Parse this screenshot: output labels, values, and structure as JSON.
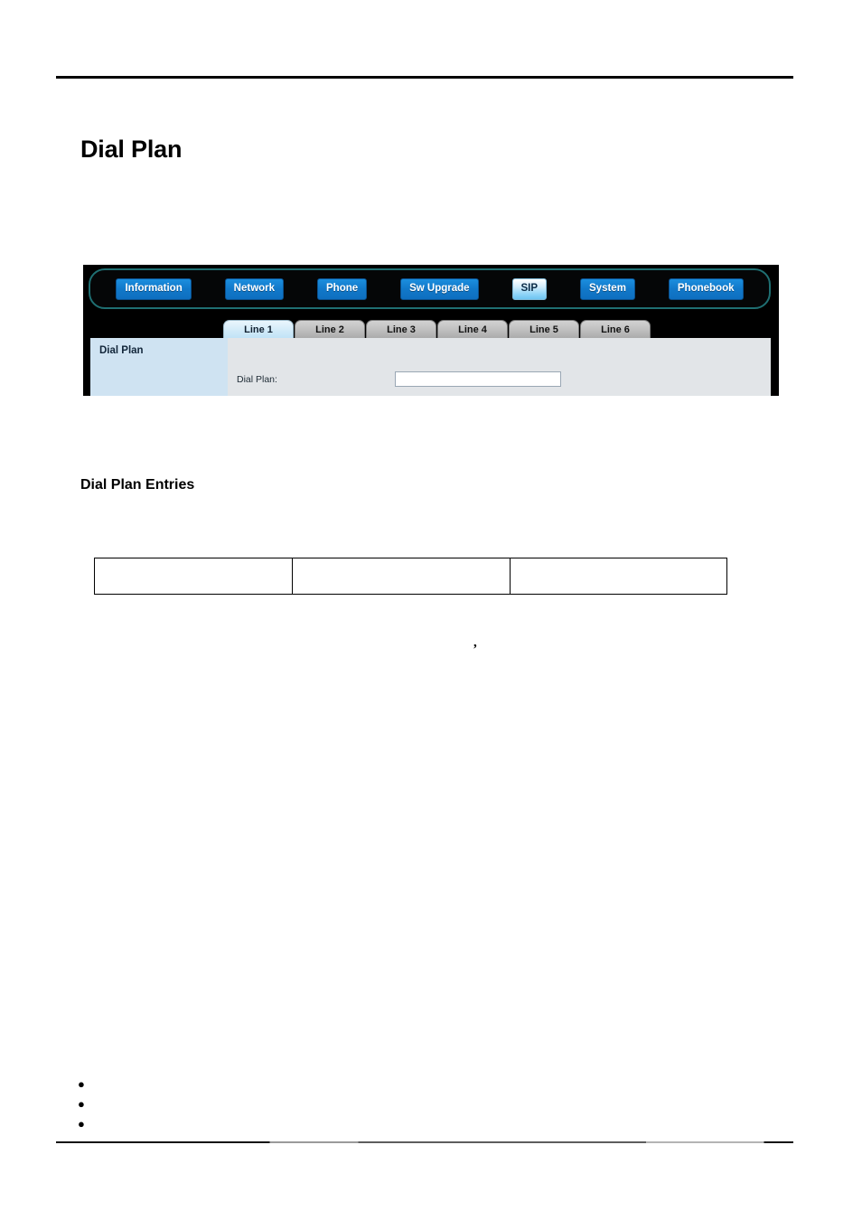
{
  "document": {
    "title": "Dial Plan",
    "section_heading": "Dial Plan Entries",
    "stray_glyph": ","
  },
  "device_ui": {
    "nav": {
      "items": [
        {
          "label": "Information",
          "active": false
        },
        {
          "label": "Network",
          "active": false
        },
        {
          "label": "Phone",
          "active": false
        },
        {
          "label": "Sw Upgrade",
          "active": false
        },
        {
          "label": "SIP",
          "active": true
        },
        {
          "label": "System",
          "active": false
        },
        {
          "label": "Phonebook",
          "active": false
        }
      ]
    },
    "tabs": [
      {
        "label": "Line 1",
        "active": true
      },
      {
        "label": "Line 2",
        "active": false
      },
      {
        "label": "Line 3",
        "active": false
      },
      {
        "label": "Line 4",
        "active": false
      },
      {
        "label": "Line 5",
        "active": false
      },
      {
        "label": "Line 6",
        "active": false
      }
    ],
    "panel": {
      "side_title": "Dial Plan",
      "field_label": "Dial Plan:",
      "field_value": "",
      "field_placeholder": ""
    },
    "colors": {
      "nav_button": "#1178c9",
      "nav_button_active": "#8fd4f7",
      "nav_border": "#1f6f72",
      "panel_side": "#cfe3f2",
      "panel_body": "#e2e5e8",
      "tab_active": "#cfe9f8",
      "tab_inactive": "#bdbdbd"
    }
  },
  "entries_table": {
    "rows": [
      {
        "cells": [
          "",
          "",
          ""
        ]
      }
    ]
  },
  "bullet_list": {
    "items": [
      "",
      "",
      ""
    ]
  }
}
